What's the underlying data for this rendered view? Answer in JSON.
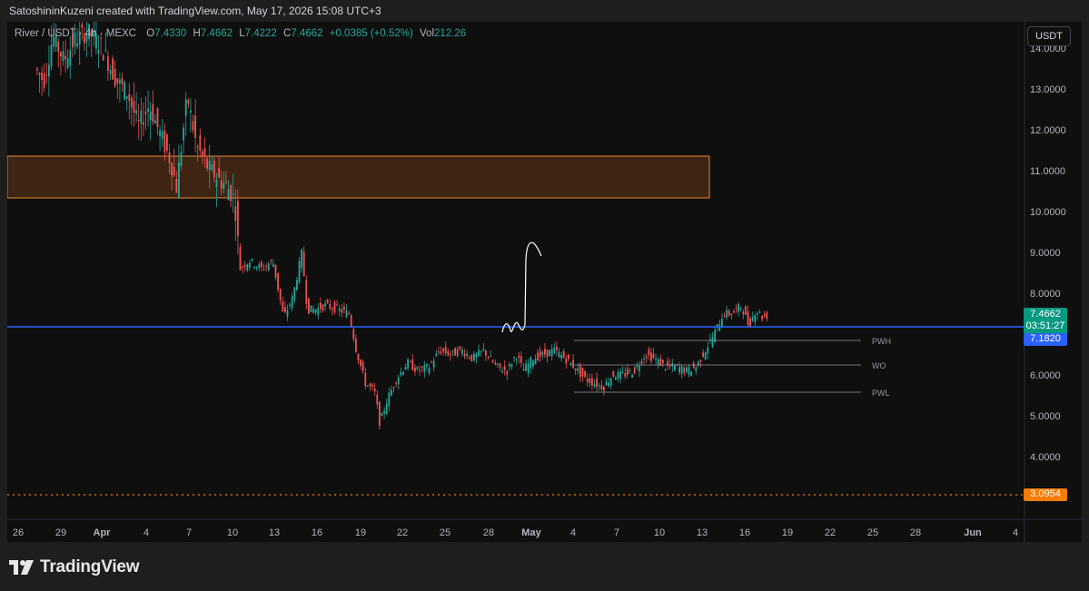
{
  "header": {
    "credit": "SatoshininKuzeni created with TradingView.com, May 17, 2026 15:08 UTC+3"
  },
  "legend": {
    "symbol": "River / USDT · 4h · MEXC",
    "open_label": "O",
    "open": "7.4330",
    "high_label": "H",
    "high": "7.4662",
    "low_label": "L",
    "low": "7.4222",
    "close_label": "C",
    "close": "7.4662",
    "change": "+0.0385 (+0.52%)",
    "vol_label": "Vol",
    "vol": "212.26"
  },
  "currency_button": "USDT",
  "price_axis": {
    "labels": [
      "14.0000",
      "13.0000",
      "12.0000",
      "11.0000",
      "10.0000",
      "9.0000",
      "8.0000",
      "6.0000",
      "5.0000",
      "4.0000"
    ],
    "current_price": "7.4662",
    "countdown": "03:51:27",
    "line_price": "7.1820",
    "low_line_price": "3.0954"
  },
  "time_axis": {
    "labels": [
      "26",
      "29",
      "Apr",
      "4",
      "7",
      "10",
      "13",
      "16",
      "19",
      "22",
      "25",
      "28",
      "May",
      "4",
      "7",
      "10",
      "13",
      "16",
      "19",
      "22",
      "25",
      "28",
      "Jun",
      "4"
    ],
    "bold": [
      "Apr",
      "May",
      "Jun"
    ]
  },
  "levels": [
    "PWH",
    "WO",
    "PWL"
  ],
  "brand": {
    "text": "TradingView"
  },
  "colors": {
    "up": "#26a69a",
    "down": "#ef5350",
    "zone_fill": "#3d2413",
    "zone_border": "#e8882e",
    "blue_line": "#2962ff",
    "orange_dot": "#f57c00",
    "badge_green": "#089981",
    "badge_blue": "#2962ff",
    "badge_orange": "#f57c00"
  },
  "icons": [
    "tradingview-logo-icon"
  ]
}
